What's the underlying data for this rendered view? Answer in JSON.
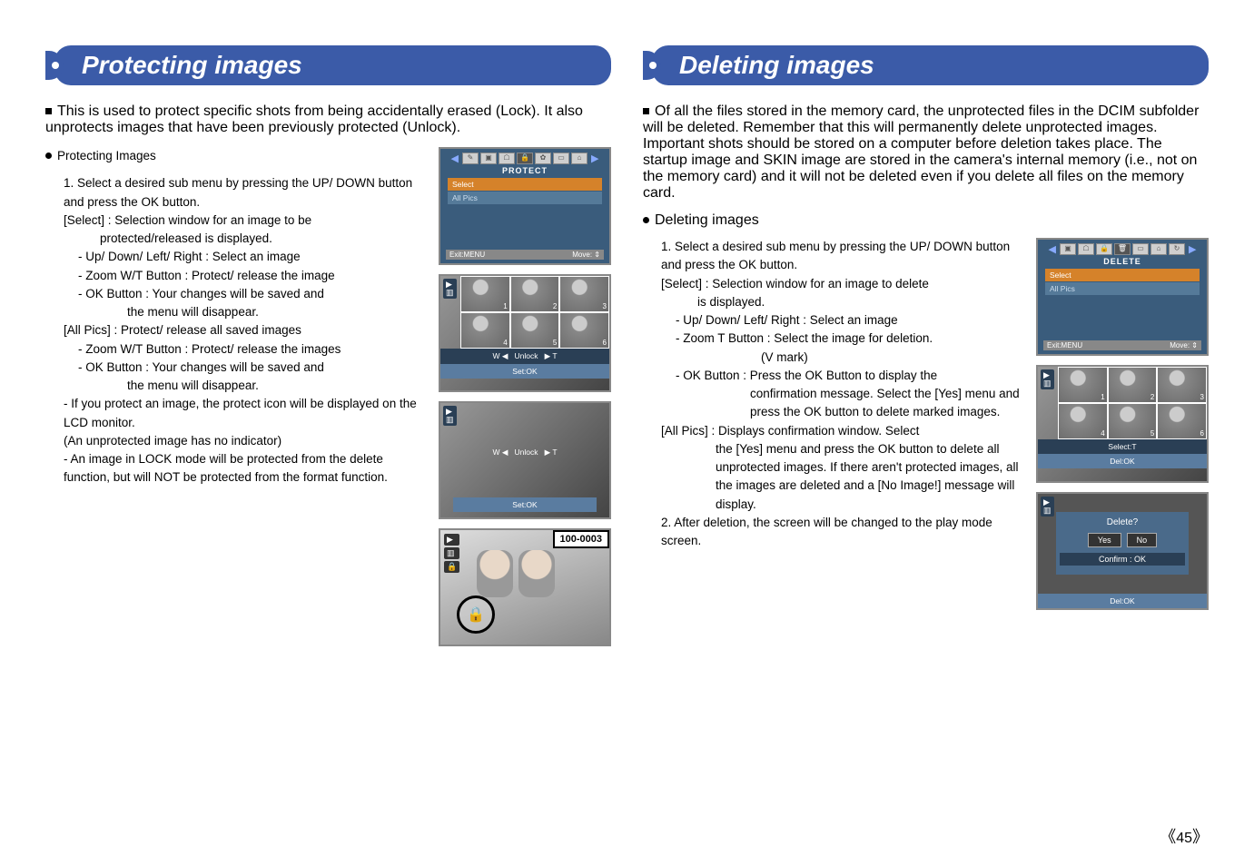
{
  "left": {
    "title": "Protecting images",
    "intro": "This is used to protect specific shots from being accidentally erased (Lock). It also unprotects images that have been previously protected (Unlock).",
    "section_heading": "Protecting Images",
    "step1": "1. Select a desired sub menu by pressing the UP/ DOWN button and press the OK button.",
    "select_label": "[Select] : Selection window for an image to be",
    "select_cont": "protected/released is displayed.",
    "b1": "- Up/ Down/ Left/ Right : Select an image",
    "b2": "- Zoom W/T Button : Protect/ release the image",
    "b3": "- OK Button : Your changes will be saved and",
    "b3b": "the menu will disappear.",
    "allpics_label": "[All Pics] : Protect/ release all saved images",
    "b4": "- Zoom W/T Button : Protect/ release the images",
    "b5": "- OK Button : Your changes will be saved and",
    "b5b": "the menu will disappear.",
    "note1": "- If you protect an image, the protect icon will be displayed on the LCD monitor.",
    "note1b": "(An unprotected image has no indicator)",
    "note2": "- An image in LOCK mode will be protected from the delete function, but will NOT be protected from the format function.",
    "menu": {
      "title": "PROTECT",
      "item1": "Select",
      "item2": "All Pics",
      "exit": "Exit:MENU",
      "move": "Move:"
    },
    "strip": {
      "w": "W ◀",
      "mid": "Unlock",
      "t": "▶ T",
      "set": "Set:OK",
      "w2": "W ◀",
      "mid2": "Unlock",
      "t2": "▶ T",
      "set2": "Set:OK"
    },
    "bigphoto": {
      "label": "100-0003",
      "play": "▶",
      "batt": "▥",
      "lock": "🔒"
    }
  },
  "right": {
    "title": "Deleting images",
    "intro": "Of all the files stored in the memory card, the unprotected files in the DCIM subfolder will be deleted. Remember that this will permanently delete unprotected images. Important shots should be stored on a computer before deletion takes place. The startup image and SKIN image are stored in the camera's internal memory (i.e., not on the memory card) and it will not be deleted even if you delete all files on the memory card.",
    "section_heading": "Deleting images",
    "step1": "1. Select a desired sub menu by pressing the UP/ DOWN button and press the OK button.",
    "select_label": "[Select] : Selection window for an image to delete",
    "select_cont": "is displayed.",
    "b1": "- Up/ Down/ Left/ Right : Select an image",
    "b2": "- Zoom T Button : Select the image for deletion.",
    "b2b": "(V mark)",
    "b3": "- OK Button : Press the OK Button to display the",
    "b3b": "confirmation message. Select the [Yes] menu and press the OK button to delete marked images.",
    "allpics_label": "[All Pics] : Displays confirmation window. Select",
    "allpics_cont": "the [Yes] menu and press the OK button to delete all unprotected images. If there aren't protected images, all the images are deleted and a [No Image!] message will display.",
    "step2": "2. After deletion, the screen will be changed to the play mode screen.",
    "menu": {
      "title": "DELETE",
      "item1": "Select",
      "item2": "All Pics",
      "exit": "Exit:MENU",
      "move": "Move:"
    },
    "strip": {
      "sel": "Select:T",
      "del": "Del:OK"
    },
    "dialog": {
      "q": "Delete?",
      "yes": "Yes",
      "no": "No",
      "confirm": "Confirm : OK",
      "del": "Del:OK"
    }
  },
  "page_number": "45"
}
